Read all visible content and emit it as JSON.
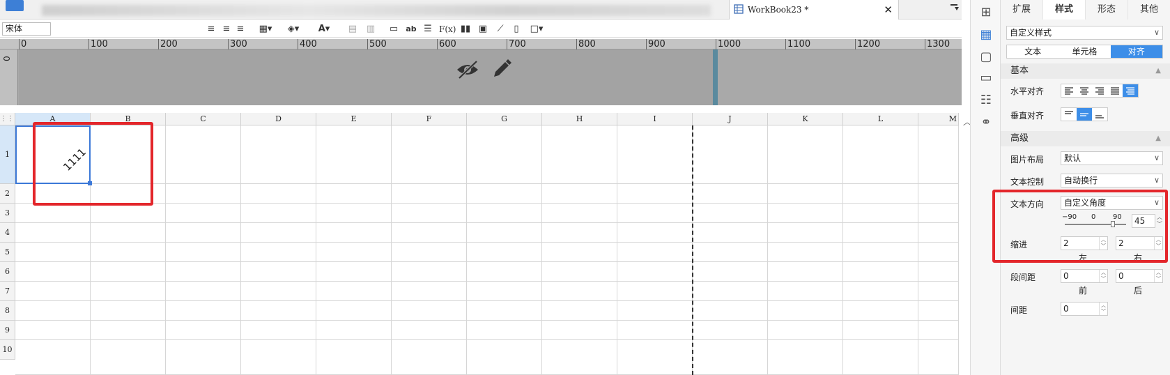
{
  "font": {
    "name": "宋体"
  },
  "tab": {
    "title": "WorkBook23 *",
    "close": "✕"
  },
  "ruler": {
    "marks": [
      "0",
      "100",
      "200",
      "300",
      "400",
      "500",
      "600",
      "700",
      "800",
      "900",
      "1000",
      "1100",
      "1200",
      "1300"
    ],
    "left_zero": "0"
  },
  "sheet": {
    "columns": [
      "A",
      "B",
      "C",
      "D",
      "E",
      "F",
      "G",
      "H",
      "I",
      "J",
      "K",
      "L",
      "M"
    ],
    "rows": [
      "1",
      "2",
      "3",
      "4",
      "5",
      "6",
      "7",
      "8",
      "9",
      "10"
    ],
    "cell_a1_value": "1111",
    "cell_a1_rotation_deg": 45
  },
  "panel": {
    "tabs": [
      "扩展",
      "样式",
      "形态",
      "其他"
    ],
    "active_tab": "样式",
    "style_select": "自定义样式",
    "sub_tabs": [
      "文本",
      "单元格",
      "对齐"
    ],
    "active_sub_tab": "对齐",
    "basic_section": "基本",
    "h_align_label": "水平对齐",
    "v_align_label": "垂直对齐",
    "advanced_section": "高级",
    "image_layout_label": "图片布局",
    "image_layout_value": "默认",
    "text_control_label": "文本控制",
    "text_control_value": "自动换行",
    "text_direction_label": "文本方向",
    "text_direction_value": "自定义角度",
    "slider_ticks": [
      "−90",
      "0",
      "90"
    ],
    "angle_value": "45",
    "indent_label": "缩进",
    "indent_left": "2",
    "indent_right": "2",
    "left_label": "左",
    "right_label": "右",
    "para_spacing_label": "段间距",
    "para_before": "0",
    "para_after": "0",
    "before_label": "前",
    "after_label": "后",
    "spacing_label": "间距",
    "spacing_value": "0"
  },
  "colors": {
    "accent": "#3d8ee8",
    "highlight": "#e3262b",
    "selection": "#3b78d8"
  }
}
